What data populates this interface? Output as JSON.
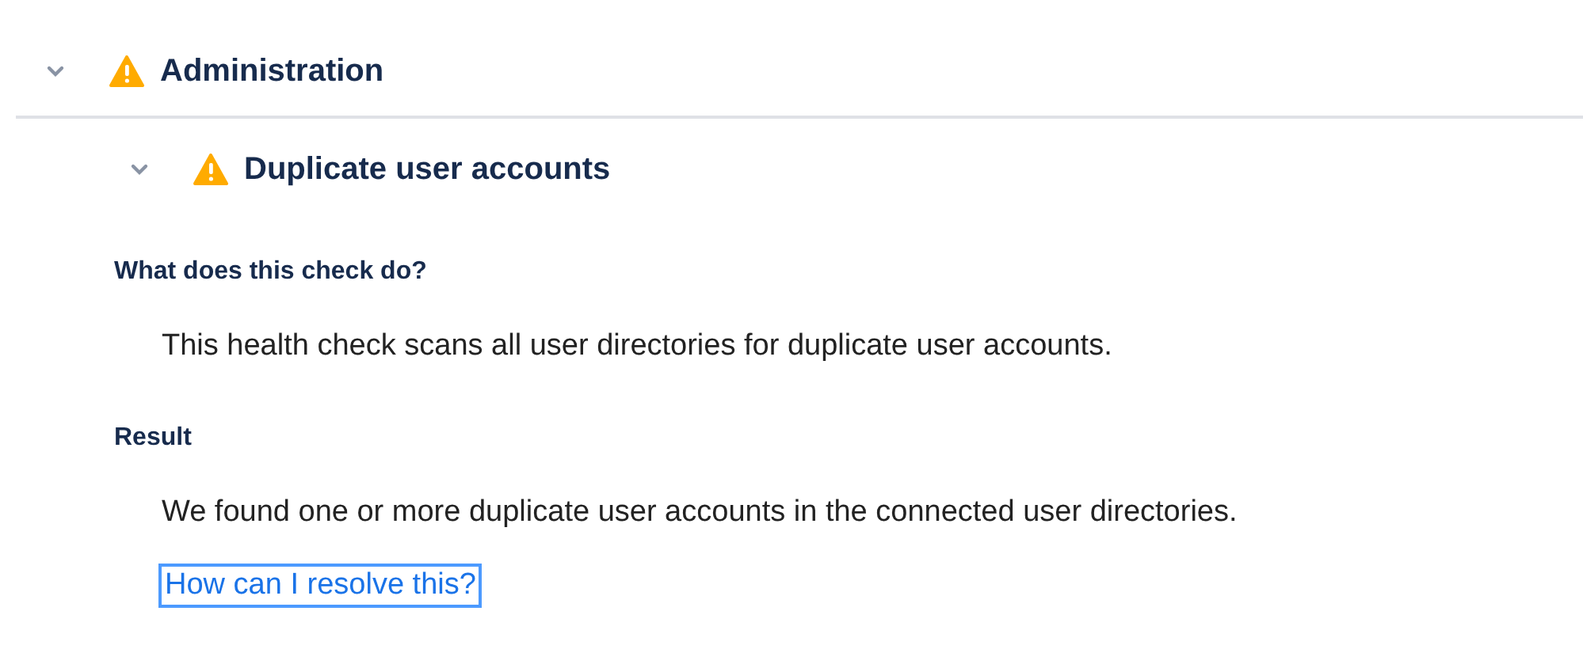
{
  "category": {
    "title": "Administration",
    "expanded": true,
    "kind": "warning"
  },
  "checks": [
    {
      "title": "Duplicate user accounts",
      "expanded": true,
      "kind": "warning",
      "sections": [
        {
          "heading": "What does this check do?",
          "text": "This health check scans all user directories for duplicate user accounts."
        },
        {
          "heading": "Result",
          "text": "We found one or more duplicate user accounts in the connected user directories."
        }
      ],
      "link": {
        "label": "How can I resolve this?",
        "focused": true
      }
    }
  ]
}
